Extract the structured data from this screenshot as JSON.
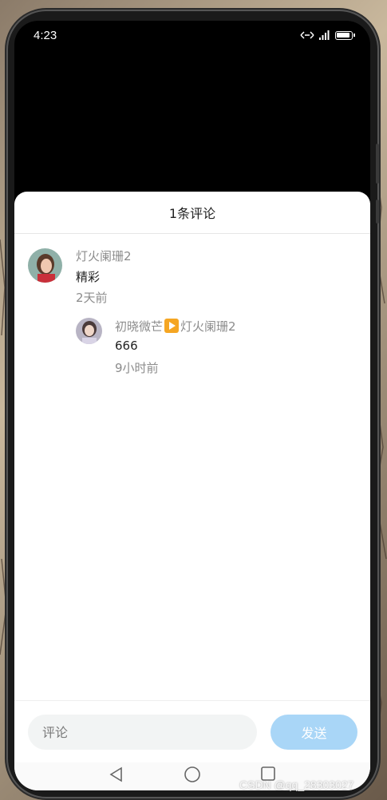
{
  "status_bar": {
    "time": "4:23"
  },
  "sheet": {
    "title": "1条评论"
  },
  "comments": [
    {
      "author": "灯火阑珊2",
      "text": "精彩",
      "time": "2天前"
    }
  ],
  "reply": {
    "author": "初晓微芒",
    "target": "灯火阑珊2",
    "text": "666",
    "time": "9小时前"
  },
  "input_bar": {
    "placeholder": "评论",
    "send_label": "发送"
  },
  "watermark": "CSDN @qq_28303027",
  "colors": {
    "send_button": "#a9d6f7",
    "input_bg": "#f2f4f4",
    "muted_text": "#8c8c8c",
    "reply_arrow": "#f5a623"
  }
}
